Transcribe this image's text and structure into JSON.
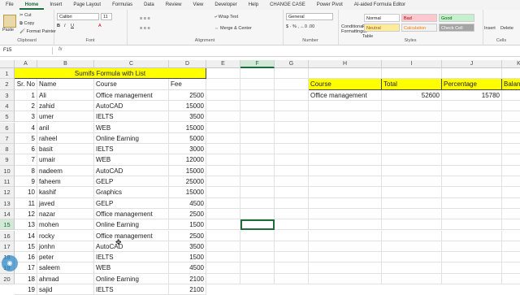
{
  "tabs": [
    "File",
    "Home",
    "Insert",
    "Page Layout",
    "Formulas",
    "Data",
    "Review",
    "View",
    "Developer",
    "Help",
    "CHANGE CASE",
    "Power Pivot",
    "AI-aided Formula Editor"
  ],
  "ribbon": {
    "clipboard": {
      "paste": "Paste",
      "cut": "Cut",
      "copy": "Copy",
      "format_painter": "Format Painter",
      "label": "Clipboard"
    },
    "font": {
      "name": "Calibri",
      "size": "11",
      "label": "Font"
    },
    "alignment": {
      "wrap": "Wrap Text",
      "merge": "Merge & Center",
      "label": "Alignment"
    },
    "number": {
      "format": "General",
      "label": "Number"
    },
    "styles": {
      "cond": "Conditional Formatting",
      "table": "Format as Table",
      "normal": "Normal",
      "bad": "Bad",
      "good": "Good",
      "neutral": "Neutral",
      "calculation": "Calculation",
      "check": "Check Cell",
      "label": "Styles"
    },
    "cells": {
      "insert": "Insert",
      "delete": "Delete",
      "label": "Cells"
    }
  },
  "namebox": "F15",
  "fx": "fx",
  "columns": [
    "A",
    "B",
    "C",
    "D",
    "E",
    "F",
    "G",
    "H",
    "I",
    "J",
    "K"
  ],
  "title": "Sumifs Formula with List",
  "headers": {
    "sr": "Sr. No",
    "name": "Name",
    "course": "Course",
    "fee": "Fee"
  },
  "rows": [
    {
      "sr": "1",
      "name": "Ali",
      "course": "Office management",
      "fee": "2500"
    },
    {
      "sr": "2",
      "name": "zahid",
      "course": "AutoCAD",
      "fee": "15000"
    },
    {
      "sr": "3",
      "name": "umer",
      "course": "IELTS",
      "fee": "3500"
    },
    {
      "sr": "4",
      "name": "anil",
      "course": "WEB",
      "fee": "15000"
    },
    {
      "sr": "5",
      "name": "raheel",
      "course": "Online Earning",
      "fee": "5000"
    },
    {
      "sr": "6",
      "name": "basit",
      "course": "IELTS",
      "fee": "3000"
    },
    {
      "sr": "7",
      "name": "umair",
      "course": "WEB",
      "fee": "12000"
    },
    {
      "sr": "8",
      "name": "nadeem",
      "course": "AutoCAD",
      "fee": "15000"
    },
    {
      "sr": "9",
      "name": "faheem",
      "course": "GELP",
      "fee": "25000"
    },
    {
      "sr": "10",
      "name": "kashif",
      "course": "Graphics",
      "fee": "15000"
    },
    {
      "sr": "11",
      "name": "javed",
      "course": "GELP",
      "fee": "4500"
    },
    {
      "sr": "12",
      "name": "nazar",
      "course": "Office management",
      "fee": "2500"
    },
    {
      "sr": "13",
      "name": "mohen",
      "course": "Online Earning",
      "fee": "1500"
    },
    {
      "sr": "14",
      "name": "rocky",
      "course": "Office management",
      "fee": "2500"
    },
    {
      "sr": "15",
      "name": "jonhn",
      "course": "AutoCAD",
      "fee": "3500"
    },
    {
      "sr": "16",
      "name": "peter",
      "course": "IELTS",
      "fee": "1500"
    },
    {
      "sr": "17",
      "name": "saleem",
      "course": "WEB",
      "fee": "4500"
    },
    {
      "sr": "18",
      "name": "ahmad",
      "course": "Online Earning",
      "fee": "2100"
    },
    {
      "sr": "19",
      "name": "sajid",
      "course": "IELTS",
      "fee": "2100"
    }
  ],
  "summary": {
    "headers": {
      "course": "Course",
      "total": "Total",
      "percentage": "Percentage",
      "balance": "Balan"
    },
    "course": "Office management",
    "total": "52600",
    "percentage": "15780"
  },
  "row_numbers": [
    "1",
    "2",
    "3",
    "4",
    "5",
    "6",
    "7",
    "8",
    "9",
    "10",
    "11",
    "12",
    "13",
    "14",
    "15",
    "16",
    "17",
    "18",
    "19",
    "20"
  ]
}
